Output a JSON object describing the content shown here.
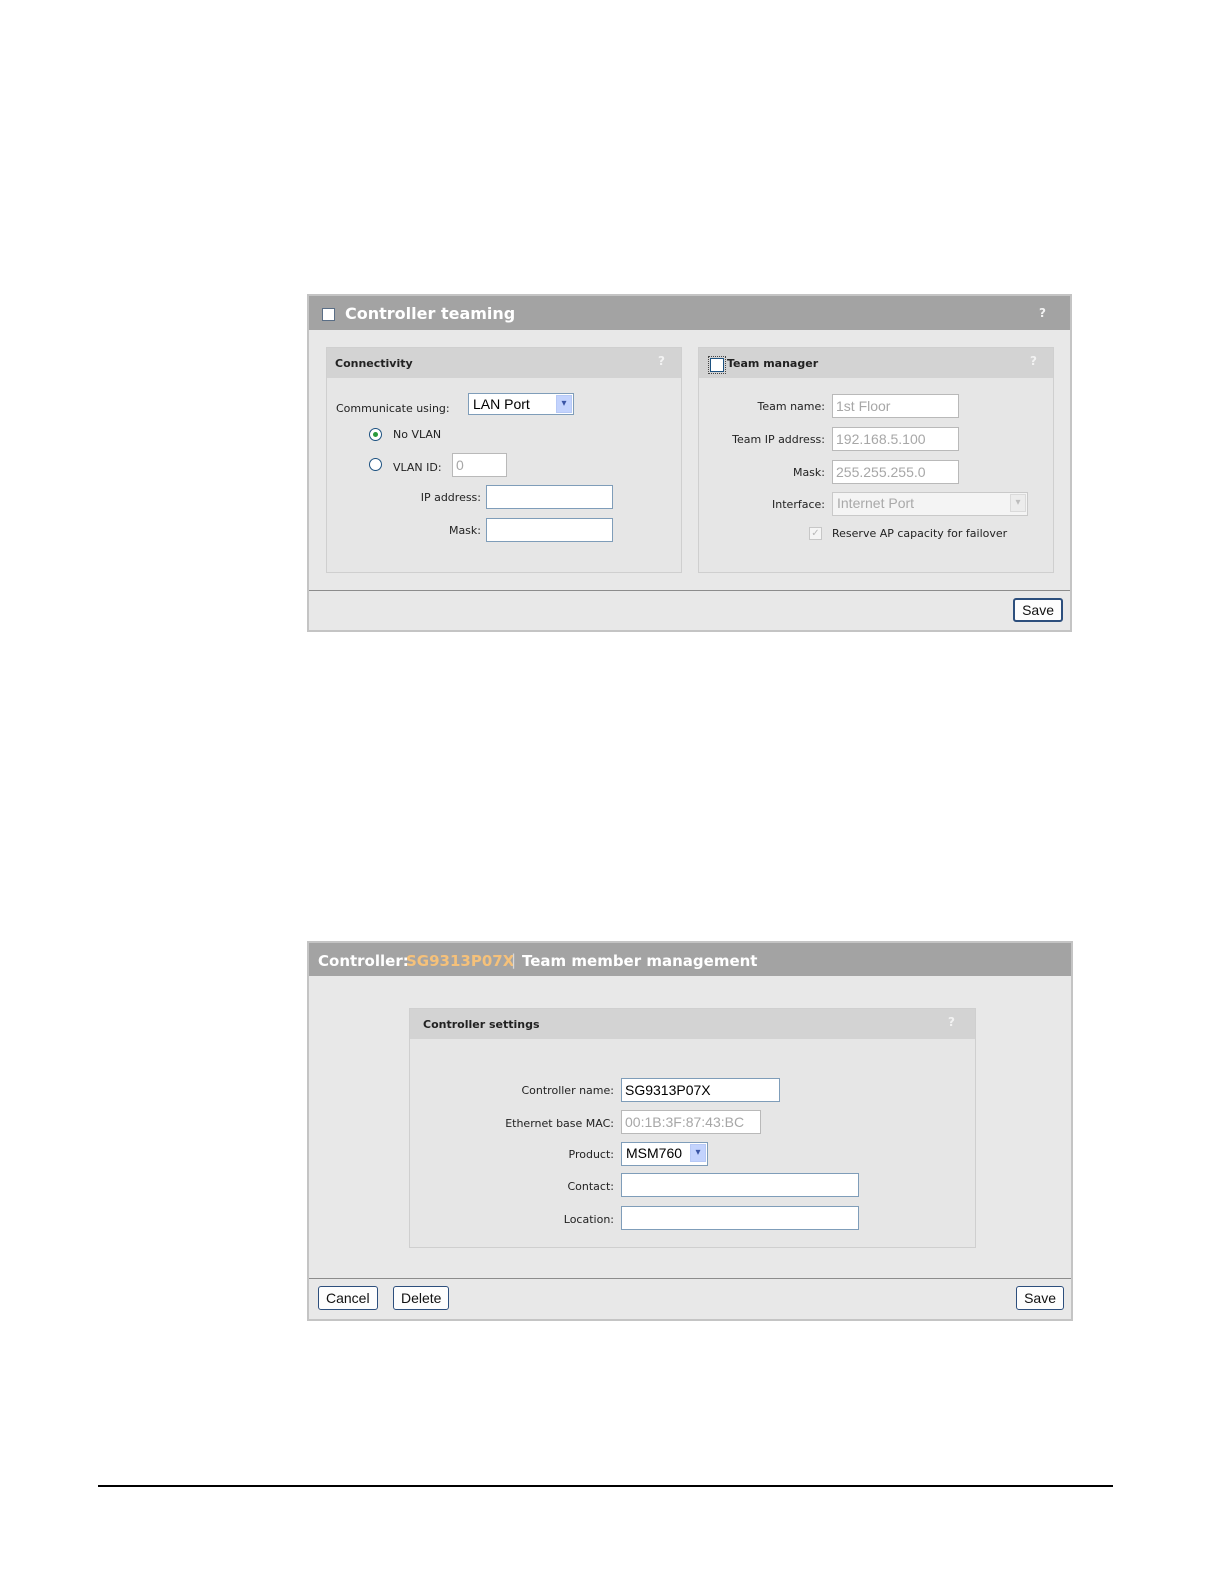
{
  "controller_teaming": {
    "title": "Controller teaming",
    "help": "?",
    "connectivity": {
      "title": "Connectivity",
      "help": "?",
      "communicate_label": "Communicate using:",
      "communicate_value": "LAN Port",
      "no_vlan_label": "No VLAN",
      "vlan_id_label": "VLAN ID:",
      "vlan_id_value": "0",
      "ip_address_label": "IP address:",
      "ip_address_value": "",
      "mask_label": "Mask:",
      "mask_value": ""
    },
    "team_manager": {
      "title": "Team manager",
      "help": "?",
      "team_name_label": "Team name:",
      "team_name_value": "1st Floor",
      "team_ip_label": "Team IP address:",
      "team_ip_value": "192.168.5.100",
      "mask_label": "Mask:",
      "mask_value": "255.255.255.0",
      "interface_label": "Interface:",
      "interface_value": "Internet Port",
      "reserve_label": "Reserve AP capacity for failover",
      "reserve_mark": "✓"
    },
    "save_label": "Save"
  },
  "team_member": {
    "header_prefix": "Controller:",
    "controller_id": "SG9313P07X",
    "separator": "|",
    "header_suffix": "Team member management",
    "settings": {
      "title": "Controller settings",
      "help": "?",
      "name_label": "Controller name:",
      "name_value": "SG9313P07X",
      "mac_label": "Ethernet base MAC:",
      "mac_value": "00:1B:3F:87:43:BC",
      "product_label": "Product:",
      "product_value": "MSM760",
      "contact_label": "Contact:",
      "contact_value": "",
      "location_label": "Location:",
      "location_value": ""
    },
    "cancel_label": "Cancel",
    "delete_label": "Delete",
    "save_label": "Save"
  },
  "icons": {
    "dropdown": "▾",
    "collapse_checkbox": "square"
  },
  "colors": {
    "header_bg": "#a3a3a3",
    "controller_id": "#f5c17a",
    "panel_bg": "#e8e8e8"
  }
}
